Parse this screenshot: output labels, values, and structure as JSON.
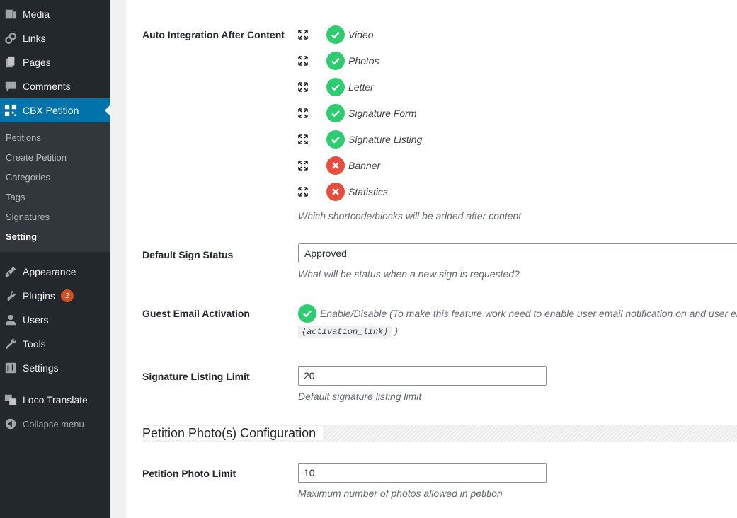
{
  "sidebar": {
    "items": [
      {
        "label": "Media",
        "icon": "media-icon"
      },
      {
        "label": "Links",
        "icon": "links-icon"
      },
      {
        "label": "Pages",
        "icon": "pages-icon"
      },
      {
        "label": "Comments",
        "icon": "comments-icon"
      },
      {
        "label": "CBX Petition",
        "icon": "cbx-petition-icon"
      }
    ],
    "submenu": [
      "Petitions",
      "Create Petition",
      "Categories",
      "Tags",
      "Signatures",
      "Setting"
    ],
    "lower_items": [
      {
        "label": "Appearance",
        "icon": "appearance-icon"
      },
      {
        "label": "Plugins",
        "icon": "plugins-icon",
        "badge": "2"
      },
      {
        "label": "Users",
        "icon": "users-icon"
      },
      {
        "label": "Tools",
        "icon": "tools-icon"
      },
      {
        "label": "Settings",
        "icon": "settings-icon"
      },
      {
        "label": "Loco Translate",
        "icon": "loco-translate-icon"
      }
    ],
    "collapse_label": "Collapse menu",
    "active_color": "#0073aa"
  },
  "settings": {
    "auto_integration": {
      "label": "Auto Integration After Content",
      "items": [
        {
          "label": "Video",
          "enabled": true
        },
        {
          "label": "Photos",
          "enabled": true
        },
        {
          "label": "Letter",
          "enabled": true
        },
        {
          "label": "Signature Form",
          "enabled": true
        },
        {
          "label": "Signature Listing",
          "enabled": true
        },
        {
          "label": "Banner",
          "enabled": false
        },
        {
          "label": "Statistics",
          "enabled": false
        }
      ],
      "description": "Which shortcode/blocks will be added after content"
    },
    "default_sign_status": {
      "label": "Default Sign Status",
      "value": "Approved",
      "description": "What will be status when a new sign is requested?"
    },
    "guest_email_activation": {
      "label": "Guest Email Activation",
      "text": "Enable/Disable (To make this feature work need to enable user email notification on and user emo",
      "code": "{activation_link}",
      "code_suffix": ")"
    },
    "signature_listing_limit": {
      "label": "Signature Listing Limit",
      "value": "20",
      "description": "Default signature listing limit"
    },
    "photo_section_title": "Petition Photo(s) Configuration",
    "petition_photo_limit": {
      "label": "Petition Photo Limit",
      "value": "10",
      "description": "Maximum number of photos allowed in petition"
    }
  },
  "colors": {
    "enabled": "#2ecc71",
    "disabled": "#e74c3c"
  }
}
